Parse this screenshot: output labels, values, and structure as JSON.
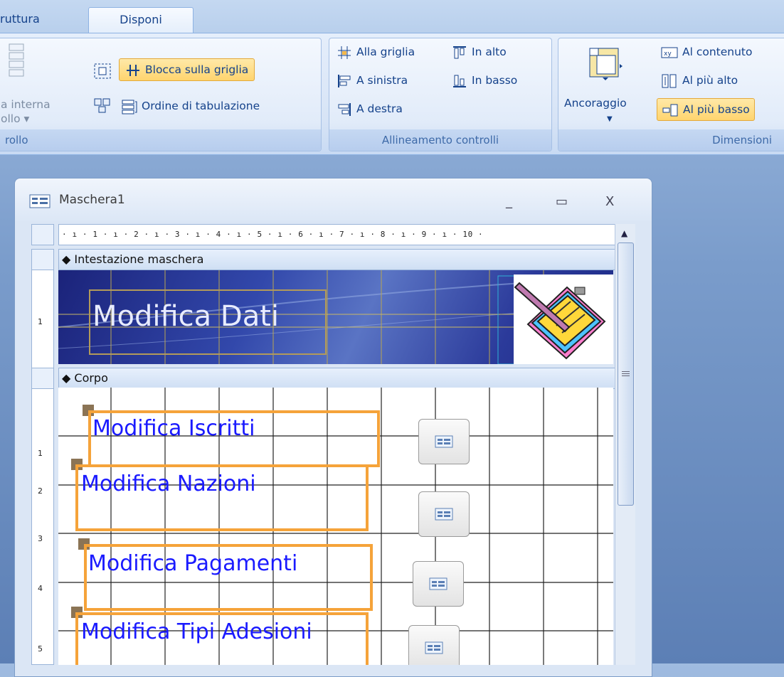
{
  "tabs": {
    "left": "ruttura",
    "active": "Disponi"
  },
  "groups": {
    "controllo": {
      "title": "rollo",
      "cut_label_line1": "a interna",
      "cut_label_line2": "ollo ▾",
      "snap_label": "Blocca sulla griglia",
      "taborder_label": "Ordine di tabulazione"
    },
    "align": {
      "title": "Allineamento controlli",
      "to_grid": "Alla griglia",
      "left": "A sinistra",
      "right": "A destra",
      "top": "In alto",
      "bottom": "In basso"
    },
    "size": {
      "title": "Dimensioni",
      "anchor": "Ancoraggio",
      "to_fit": "Al contenuto",
      "to_tallest": "Al più alto",
      "to_shortest": "Al più basso"
    }
  },
  "form_window": {
    "title": "Maschera1",
    "minimize": "_",
    "maximize": "▭",
    "close": "X",
    "ruler_text": "· ı · 1 · ı · 2 · ı · 3 · ı · 4 · ı · 5 · ı · 6 · ı · 7 · ı · 8 · ı · 9 · ı · 10 ·",
    "section_header": "◆ Intestazione maschera",
    "section_body": "◆ Corpo",
    "header_title": "Modifica Dati",
    "v_ticks": [
      "1",
      "1",
      "2",
      "3",
      "4",
      "5"
    ]
  },
  "controls": [
    {
      "label": "Modifica Iscritti"
    },
    {
      "label": "Modifica Nazioni"
    },
    {
      "label": "Modifica Pagamenti"
    },
    {
      "label": "Modifica Tipi Adesioni"
    }
  ],
  "colors": {
    "accent": "#15428b",
    "selection": "#f5a33a",
    "label_text": "#1a1aff"
  }
}
